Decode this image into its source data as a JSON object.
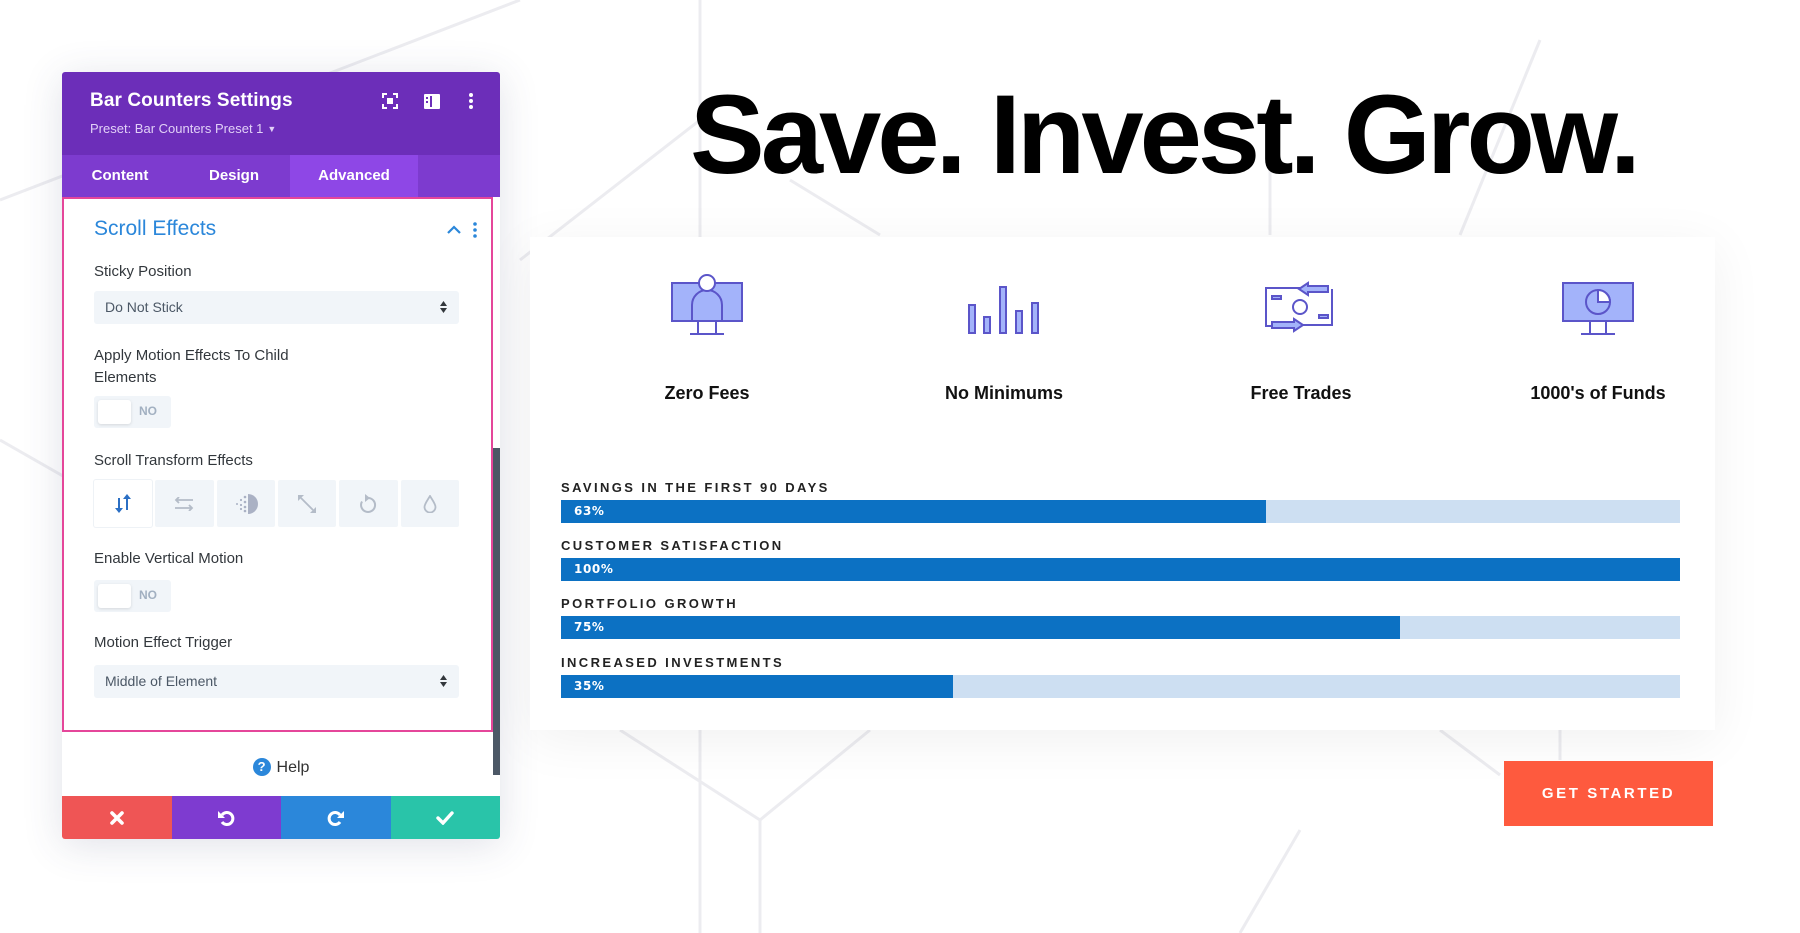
{
  "panel": {
    "title": "Bar Counters Settings",
    "preset": "Preset: Bar Counters Preset 1",
    "header_icons": [
      "focus-icon",
      "layout-split-icon",
      "more-vertical-icon"
    ],
    "tabs": [
      {
        "label": "Content",
        "active": false
      },
      {
        "label": "Design",
        "active": false
      },
      {
        "label": "Advanced",
        "active": true
      }
    ],
    "section": {
      "title": "Scroll Effects",
      "expanded": true,
      "fields": {
        "sticky_position": {
          "label": "Sticky Position",
          "value": "Do Not Stick"
        },
        "apply_motion_child": {
          "label": "Apply Motion Effects To Child Elements",
          "value": "NO"
        },
        "scroll_transform": {
          "label": "Scroll Transform Effects",
          "options": [
            "vertical-motion",
            "horizontal-motion",
            "fading-in-out",
            "scaling",
            "rotating",
            "blur"
          ],
          "active": "vertical-motion"
        },
        "enable_vertical_motion": {
          "label": "Enable Vertical Motion",
          "value": "NO"
        },
        "motion_trigger": {
          "label": "Motion Effect Trigger",
          "value": "Middle of Element"
        }
      }
    },
    "help_label": "Help",
    "footer_buttons": [
      "cancel",
      "undo",
      "redo",
      "save"
    ]
  },
  "colors": {
    "panel_header": "#6c2eb9",
    "tab_bar": "#7d3bcf",
    "tab_active": "#8e47e6",
    "section_border": "#e5469a",
    "section_title": "#2b87da",
    "bar_fill": "#0c71c3",
    "bar_track": "#cddff2",
    "cta": "#fe5a3e",
    "cancel": "#ef5555",
    "undo": "#7e3bd0",
    "redo": "#2b87da",
    "save": "#29c4a9",
    "icon_fill": "#a3b3fa",
    "icon_stroke": "#5b55c9"
  },
  "page": {
    "headline": "Save. Invest. Grow.",
    "features": [
      {
        "icon": "monitor-person-icon",
        "label": "Zero Fees"
      },
      {
        "icon": "bar-chart-icon",
        "label": "No Minimums"
      },
      {
        "icon": "money-exchange-icon",
        "label": "Free Trades"
      },
      {
        "icon": "monitor-pie-chart-icon",
        "label": "1000's of Funds"
      }
    ],
    "bars": [
      {
        "label": "SAVINGS IN THE FIRST 90 DAYS",
        "percent": 63,
        "display": "63%"
      },
      {
        "label": "CUSTOMER SATISFACTION",
        "percent": 100,
        "display": "100%"
      },
      {
        "label": "PORTFOLIO GROWTH",
        "percent": 75,
        "display": "75%"
      },
      {
        "label": "INCREASED INVESTMENTS",
        "percent": 35,
        "display": "35%"
      }
    ],
    "cta_label": "GET STARTED"
  }
}
